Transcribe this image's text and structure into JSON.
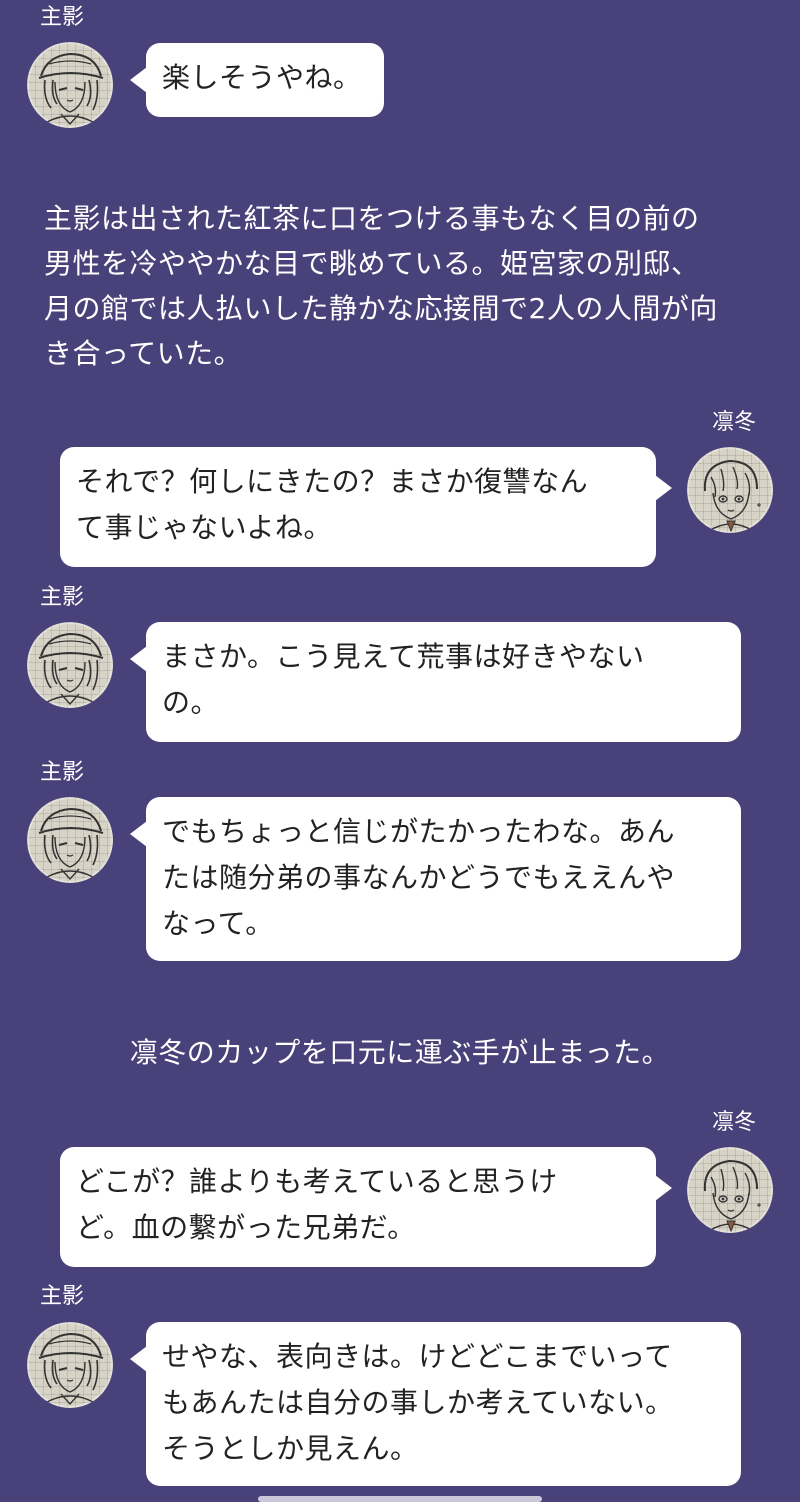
{
  "colors": {
    "background": "#49427a",
    "bubble": "#ffffff",
    "bubble_text": "#222222",
    "narration_text": "#ffffff"
  },
  "messages": [
    {
      "speaker": "主影",
      "side": "left",
      "avatar": "shuei-avatar-icon",
      "text": "楽しそうやね。"
    },
    {
      "type": "narration",
      "text": "主影は出された紅茶に口をつける事もなく目の前の\n男性を冷ややかな目で眺めている。姫宮家の別邸、\n月の館では人払いした静かな応接間で2人の人間が向\nき合っていた。"
    },
    {
      "speaker": "凛冬",
      "side": "right",
      "avatar": "rinto-avatar-icon",
      "text": "それで？何しにきたの？まさか復讐なん\nて事じゃないよね。"
    },
    {
      "speaker": "主影",
      "side": "left",
      "avatar": "shuei-avatar-icon",
      "text": "まさか。こう見えて荒事は好きやない\nの。"
    },
    {
      "speaker": "主影",
      "side": "left",
      "avatar": "shuei-avatar-icon",
      "text": "でもちょっと信じがたかったわな。あん\nたは随分弟の事なんかどうでもええんや\nなって。"
    },
    {
      "type": "narration",
      "text": "凛冬のカップを口元に運ぶ手が止まった。"
    },
    {
      "speaker": "凛冬",
      "side": "right",
      "avatar": "rinto-avatar-icon",
      "text": "どこが？誰よりも考えていると思うけ\nど。血の繋がった兄弟だ。"
    },
    {
      "speaker": "主影",
      "side": "left",
      "avatar": "shuei-avatar-icon",
      "text": "せやな、表向きは。けどどこまでいって\nもあんたは自分の事しか考えていない。\nそうとしか見えん。"
    }
  ]
}
